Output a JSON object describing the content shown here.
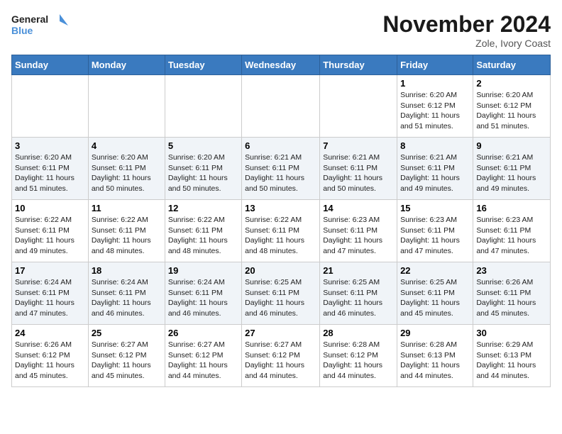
{
  "logo": {
    "line1": "General",
    "line2": "Blue"
  },
  "title": "November 2024",
  "location": "Zole, Ivory Coast",
  "days_of_week": [
    "Sunday",
    "Monday",
    "Tuesday",
    "Wednesday",
    "Thursday",
    "Friday",
    "Saturday"
  ],
  "weeks": [
    [
      {
        "num": "",
        "info": ""
      },
      {
        "num": "",
        "info": ""
      },
      {
        "num": "",
        "info": ""
      },
      {
        "num": "",
        "info": ""
      },
      {
        "num": "",
        "info": ""
      },
      {
        "num": "1",
        "info": "Sunrise: 6:20 AM\nSunset: 6:12 PM\nDaylight: 11 hours\nand 51 minutes."
      },
      {
        "num": "2",
        "info": "Sunrise: 6:20 AM\nSunset: 6:12 PM\nDaylight: 11 hours\nand 51 minutes."
      }
    ],
    [
      {
        "num": "3",
        "info": "Sunrise: 6:20 AM\nSunset: 6:11 PM\nDaylight: 11 hours\nand 51 minutes."
      },
      {
        "num": "4",
        "info": "Sunrise: 6:20 AM\nSunset: 6:11 PM\nDaylight: 11 hours\nand 50 minutes."
      },
      {
        "num": "5",
        "info": "Sunrise: 6:20 AM\nSunset: 6:11 PM\nDaylight: 11 hours\nand 50 minutes."
      },
      {
        "num": "6",
        "info": "Sunrise: 6:21 AM\nSunset: 6:11 PM\nDaylight: 11 hours\nand 50 minutes."
      },
      {
        "num": "7",
        "info": "Sunrise: 6:21 AM\nSunset: 6:11 PM\nDaylight: 11 hours\nand 50 minutes."
      },
      {
        "num": "8",
        "info": "Sunrise: 6:21 AM\nSunset: 6:11 PM\nDaylight: 11 hours\nand 49 minutes."
      },
      {
        "num": "9",
        "info": "Sunrise: 6:21 AM\nSunset: 6:11 PM\nDaylight: 11 hours\nand 49 minutes."
      }
    ],
    [
      {
        "num": "10",
        "info": "Sunrise: 6:22 AM\nSunset: 6:11 PM\nDaylight: 11 hours\nand 49 minutes."
      },
      {
        "num": "11",
        "info": "Sunrise: 6:22 AM\nSunset: 6:11 PM\nDaylight: 11 hours\nand 48 minutes."
      },
      {
        "num": "12",
        "info": "Sunrise: 6:22 AM\nSunset: 6:11 PM\nDaylight: 11 hours\nand 48 minutes."
      },
      {
        "num": "13",
        "info": "Sunrise: 6:22 AM\nSunset: 6:11 PM\nDaylight: 11 hours\nand 48 minutes."
      },
      {
        "num": "14",
        "info": "Sunrise: 6:23 AM\nSunset: 6:11 PM\nDaylight: 11 hours\nand 47 minutes."
      },
      {
        "num": "15",
        "info": "Sunrise: 6:23 AM\nSunset: 6:11 PM\nDaylight: 11 hours\nand 47 minutes."
      },
      {
        "num": "16",
        "info": "Sunrise: 6:23 AM\nSunset: 6:11 PM\nDaylight: 11 hours\nand 47 minutes."
      }
    ],
    [
      {
        "num": "17",
        "info": "Sunrise: 6:24 AM\nSunset: 6:11 PM\nDaylight: 11 hours\nand 47 minutes."
      },
      {
        "num": "18",
        "info": "Sunrise: 6:24 AM\nSunset: 6:11 PM\nDaylight: 11 hours\nand 46 minutes."
      },
      {
        "num": "19",
        "info": "Sunrise: 6:24 AM\nSunset: 6:11 PM\nDaylight: 11 hours\nand 46 minutes."
      },
      {
        "num": "20",
        "info": "Sunrise: 6:25 AM\nSunset: 6:11 PM\nDaylight: 11 hours\nand 46 minutes."
      },
      {
        "num": "21",
        "info": "Sunrise: 6:25 AM\nSunset: 6:11 PM\nDaylight: 11 hours\nand 46 minutes."
      },
      {
        "num": "22",
        "info": "Sunrise: 6:25 AM\nSunset: 6:11 PM\nDaylight: 11 hours\nand 45 minutes."
      },
      {
        "num": "23",
        "info": "Sunrise: 6:26 AM\nSunset: 6:11 PM\nDaylight: 11 hours\nand 45 minutes."
      }
    ],
    [
      {
        "num": "24",
        "info": "Sunrise: 6:26 AM\nSunset: 6:12 PM\nDaylight: 11 hours\nand 45 minutes."
      },
      {
        "num": "25",
        "info": "Sunrise: 6:27 AM\nSunset: 6:12 PM\nDaylight: 11 hours\nand 45 minutes."
      },
      {
        "num": "26",
        "info": "Sunrise: 6:27 AM\nSunset: 6:12 PM\nDaylight: 11 hours\nand 44 minutes."
      },
      {
        "num": "27",
        "info": "Sunrise: 6:27 AM\nSunset: 6:12 PM\nDaylight: 11 hours\nand 44 minutes."
      },
      {
        "num": "28",
        "info": "Sunrise: 6:28 AM\nSunset: 6:12 PM\nDaylight: 11 hours\nand 44 minutes."
      },
      {
        "num": "29",
        "info": "Sunrise: 6:28 AM\nSunset: 6:13 PM\nDaylight: 11 hours\nand 44 minutes."
      },
      {
        "num": "30",
        "info": "Sunrise: 6:29 AM\nSunset: 6:13 PM\nDaylight: 11 hours\nand 44 minutes."
      }
    ]
  ]
}
